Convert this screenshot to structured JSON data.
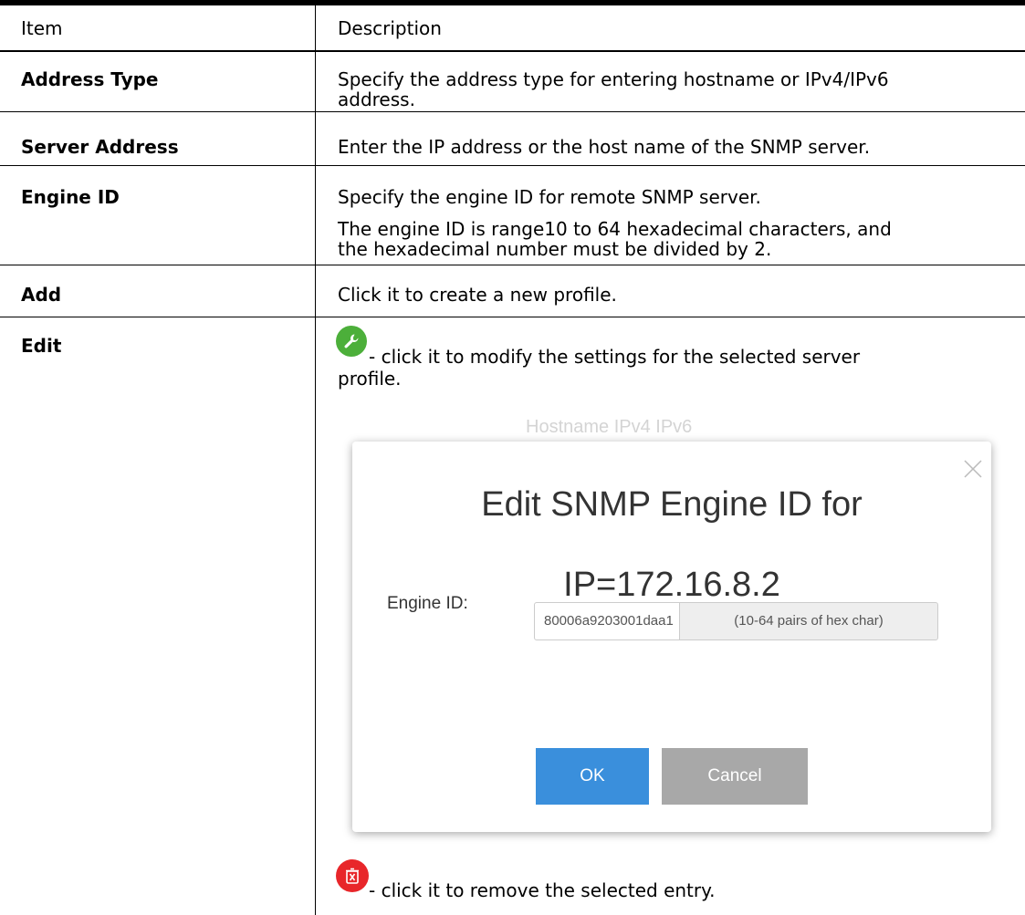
{
  "table": {
    "headers": {
      "item": "Item",
      "description": "Description"
    },
    "rows": [
      {
        "item": "Address Type",
        "desc": [
          "Specify the address type for entering hostname or IPv4/IPv6",
          "address."
        ]
      },
      {
        "item": "Server Address",
        "desc": [
          "Enter the IP address or the host name of the SNMP server."
        ]
      },
      {
        "item": "Engine ID",
        "desc": [
          "Specify the engine ID for remote SNMP server.",
          "The engine ID is range10 to 64 hexadecimal characters, and",
          "the hexadecimal number must be divided by 2."
        ]
      },
      {
        "item": "Add",
        "desc": [
          "Click it to create a new profile."
        ]
      },
      {
        "item": "Edit",
        "desc": [
          "- click it to modify the settings for the selected server",
          "profile.",
          "- click it to remove the selected entry."
        ]
      }
    ]
  },
  "icons": {
    "edit": "wrench-icon",
    "delete": "trash-icon",
    "edit_color": "#4caf3a",
    "delete_color": "#e8262a"
  },
  "background_radio": "Hostname  IPv4  IPv6",
  "modal": {
    "title_line1": "Edit SNMP Engine ID for",
    "title_line2": "IP=172.16.8.2",
    "field_label": "Engine ID:",
    "field_value": "80006a9203001daa1",
    "field_hint": "(10-64 pairs of hex char)",
    "ok_label": "OK",
    "cancel_label": "Cancel",
    "ok_color": "#3a8fdc",
    "cancel_color": "#a8a8a8"
  }
}
